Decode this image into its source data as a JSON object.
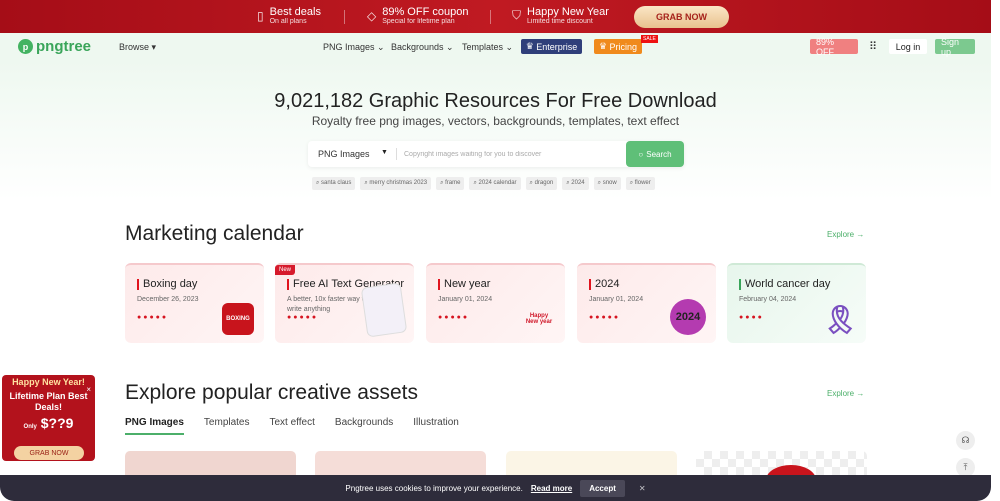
{
  "banner": {
    "items": [
      {
        "icon": "ticket-icon",
        "title": "Best deals",
        "sub": "On all plans"
      },
      {
        "icon": "tag-icon",
        "title": "89% OFF coupon",
        "sub": "Special for lifetime plan"
      },
      {
        "icon": "shield-icon",
        "title": "Happy New Year",
        "sub": "Limited time discount"
      }
    ],
    "cta": "GRAB NOW"
  },
  "nav": {
    "logo": "pngtree",
    "browse": "Browse ▾",
    "links": [
      "PNG Images",
      "Backgrounds",
      "Templates"
    ],
    "enterprise": "Enterprise",
    "pricing": "Pricing",
    "sale": "SALE",
    "discount": "89% OFF",
    "login": "Log in",
    "signup": "Sign up"
  },
  "hero": {
    "title": "9,021,182 Graphic Resources For Free Download",
    "subtitle": "Royalty free png images, vectors, backgrounds, templates, text effect",
    "search_type": "PNG Images",
    "placeholder": "Copyright images waiting for you to discover",
    "search_button": "Search",
    "tags": [
      "santa claus",
      "merry christmas 2023",
      "frame",
      "2024 calendar",
      "dragon",
      "2024",
      "snow",
      "flower"
    ]
  },
  "calendar": {
    "title": "Marketing calendar",
    "explore": "Explore →",
    "cards": [
      {
        "title": "Boxing day",
        "date": "December 26, 2023",
        "dots": "●●●●●",
        "art": "BOXING"
      },
      {
        "title": "Free AI Text Generator",
        "date": "A better, 10x faster way to write anything",
        "dots": "●●●●●",
        "badge": "New"
      },
      {
        "title": "New year",
        "date": "January 01, 2024",
        "dots": "●●●●●",
        "art": "Happy New year"
      },
      {
        "title": "2024",
        "date": "January 01, 2024",
        "dots": "●●●●●",
        "art": "2024"
      },
      {
        "title": "World cancer day",
        "date": "February 04, 2024",
        "dots": "●●●●"
      }
    ]
  },
  "assets": {
    "title": "Explore popular creative assets",
    "explore": "Explore →",
    "tabs": [
      "PNG Images",
      "Templates",
      "Text effect",
      "Backgrounds",
      "Illustration"
    ]
  },
  "promo": {
    "headline": "Happy New Year!",
    "body": "Lifetime Plan Best Deals!",
    "only": "Only",
    "price": "$??9",
    "cta": "GRAB NOW"
  },
  "cookie": {
    "text": "Pngtree uses cookies to improve your experience.",
    "link": "Read more",
    "accept": "Accept"
  }
}
